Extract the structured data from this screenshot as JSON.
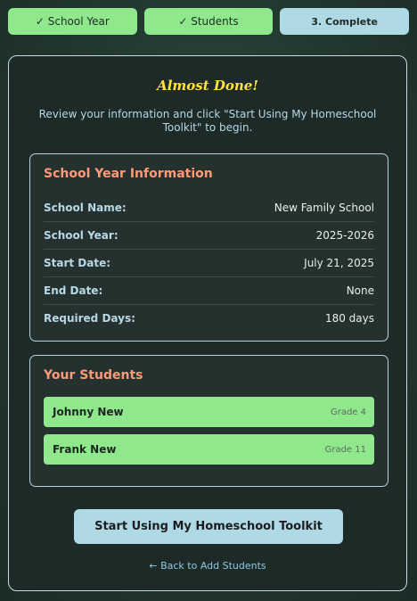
{
  "steps": [
    {
      "label": "✓ School Year"
    },
    {
      "label": "✓ Students"
    },
    {
      "label": "3. Complete"
    }
  ],
  "header": {
    "title": "Almost Done!",
    "subtitle": "Review your information and click \"Start Using My Homeschool Toolkit\" to begin."
  },
  "school": {
    "title": "School Year Information",
    "rows": [
      {
        "label": "School Name:",
        "value": "New Family School"
      },
      {
        "label": "School Year:",
        "value": "2025-2026"
      },
      {
        "label": "Start Date:",
        "value": "July 21, 2025"
      },
      {
        "label": "End Date:",
        "value": "None"
      },
      {
        "label": "Required Days:",
        "value": "180 days"
      }
    ]
  },
  "students": {
    "title": "Your Students",
    "items": [
      {
        "name": "Johnny New",
        "grade": "Grade 4"
      },
      {
        "name": "Frank New",
        "grade": "Grade 11"
      }
    ]
  },
  "actions": {
    "start_label": "Start Using My Homeschool Toolkit",
    "back_label": "← Back to Add Students"
  },
  "colors": {
    "accent_green": "#8fe88c",
    "accent_blue": "#b0d9e6",
    "heading_orange": "#ff9a78",
    "title_yellow": "#ffe23b"
  }
}
